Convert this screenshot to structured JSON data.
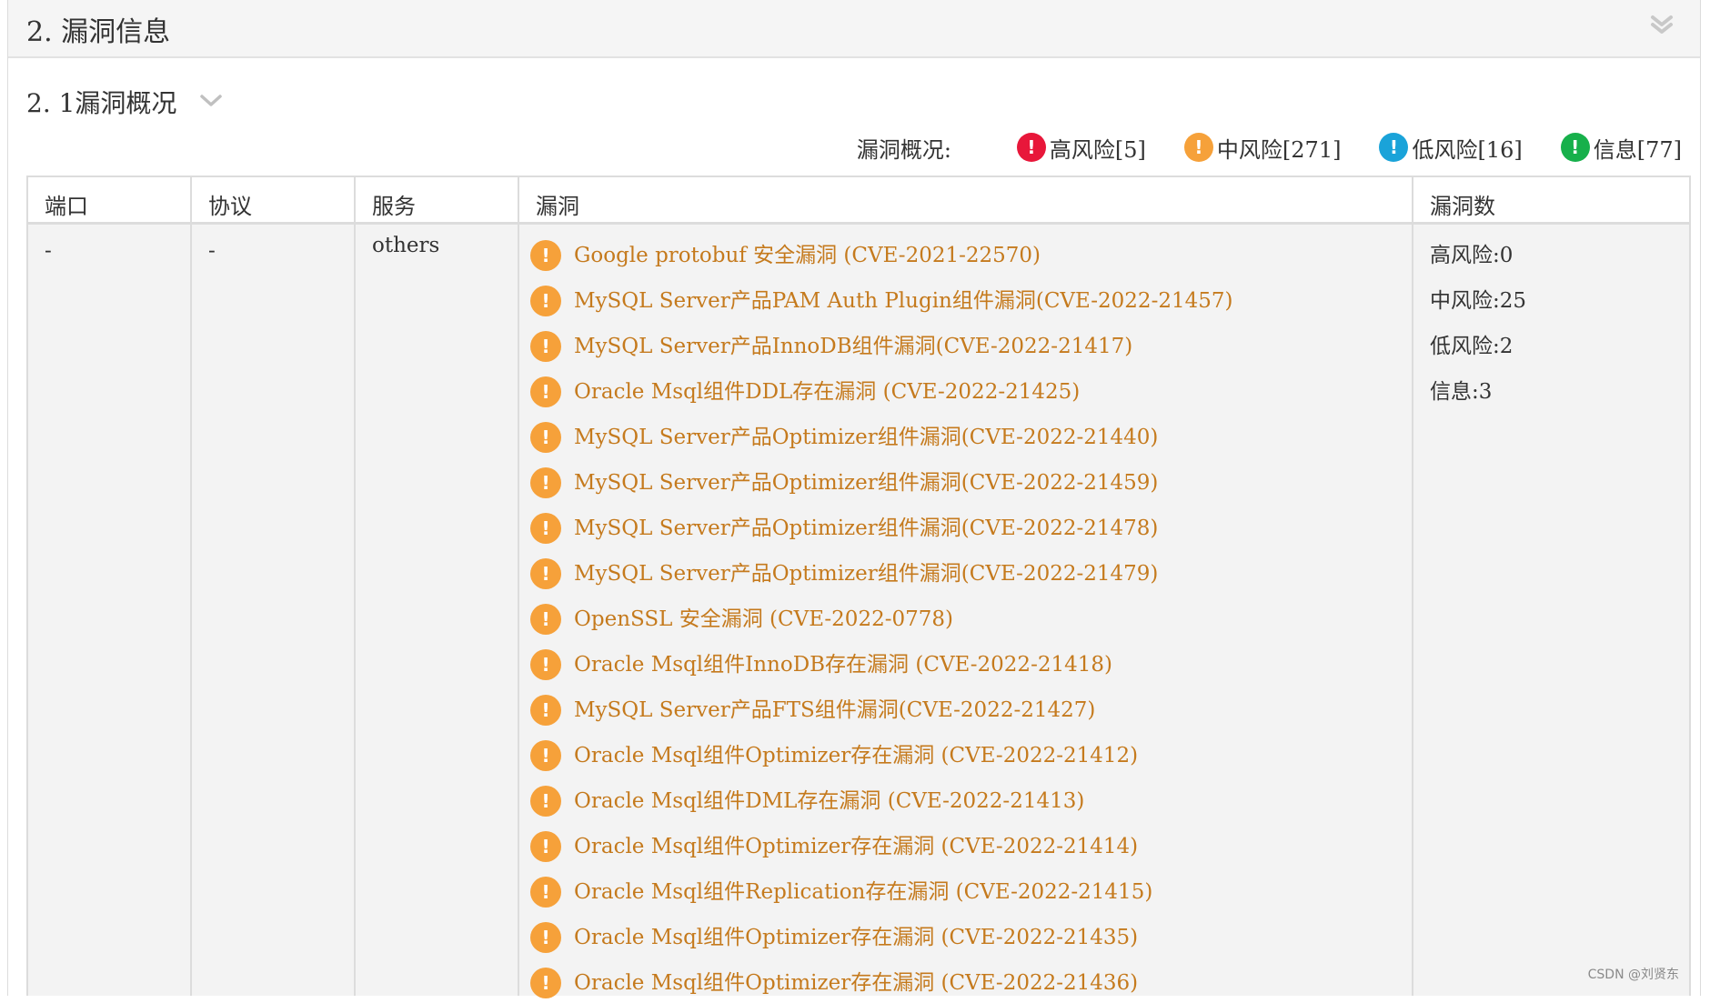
{
  "section": {
    "title": "2. 漏洞信息"
  },
  "subsection": {
    "title": "2. 1漏洞概况"
  },
  "summary": {
    "label": "漏洞概况:",
    "levels": [
      {
        "label": "高风险[5]",
        "color": "#e8173a",
        "icon": "alert-icon"
      },
      {
        "label": "中风险[271]",
        "color": "#f6a13a",
        "icon": "alert-icon"
      },
      {
        "label": "低风险[16]",
        "color": "#1aa3d9",
        "icon": "alert-icon"
      },
      {
        "label": "信息[77]",
        "color": "#17b04b",
        "icon": "alert-icon"
      }
    ]
  },
  "table": {
    "headers": {
      "port": "端口",
      "protocol": "协议",
      "service": "服务",
      "vuln": "漏洞",
      "count": "漏洞数"
    },
    "row": {
      "port": "-",
      "protocol": "-",
      "service": "others",
      "vulns": [
        "Google protobuf 安全漏洞 (CVE-2021-22570)",
        "MySQL Server产品PAM Auth Plugin组件漏洞(CVE-2022-21457)",
        "MySQL Server产品InnoDB组件漏洞(CVE-2022-21417)",
        "Oracle Msql组件DDL存在漏洞 (CVE-2022-21425)",
        "MySQL Server产品Optimizer组件漏洞(CVE-2022-21440)",
        "MySQL Server产品Optimizer组件漏洞(CVE-2022-21459)",
        "MySQL Server产品Optimizer组件漏洞(CVE-2022-21478)",
        "MySQL Server产品Optimizer组件漏洞(CVE-2022-21479)",
        "OpenSSL 安全漏洞 (CVE-2022-0778)",
        "Oracle Msql组件InnoDB存在漏洞 (CVE-2022-21418)",
        "MySQL Server产品FTS组件漏洞(CVE-2022-21427)",
        "Oracle Msql组件Optimizer存在漏洞 (CVE-2022-21412)",
        "Oracle Msql组件DML存在漏洞 (CVE-2022-21413)",
        "Oracle Msql组件Optimizer存在漏洞 (CVE-2022-21414)",
        "Oracle Msql组件Replication存在漏洞 (CVE-2022-21415)",
        "Oracle Msql组件Optimizer存在漏洞 (CVE-2022-21435)",
        "Oracle Msql组件Optimizer存在漏洞 (CVE-2022-21436)"
      ],
      "vuln_icon": "alert-icon",
      "vuln_color": "#f6a13a",
      "counts": [
        "高风险:0",
        "中风险:25",
        "低风险:2",
        "信息:3"
      ]
    }
  },
  "watermark": "CSDN @刘贤东"
}
